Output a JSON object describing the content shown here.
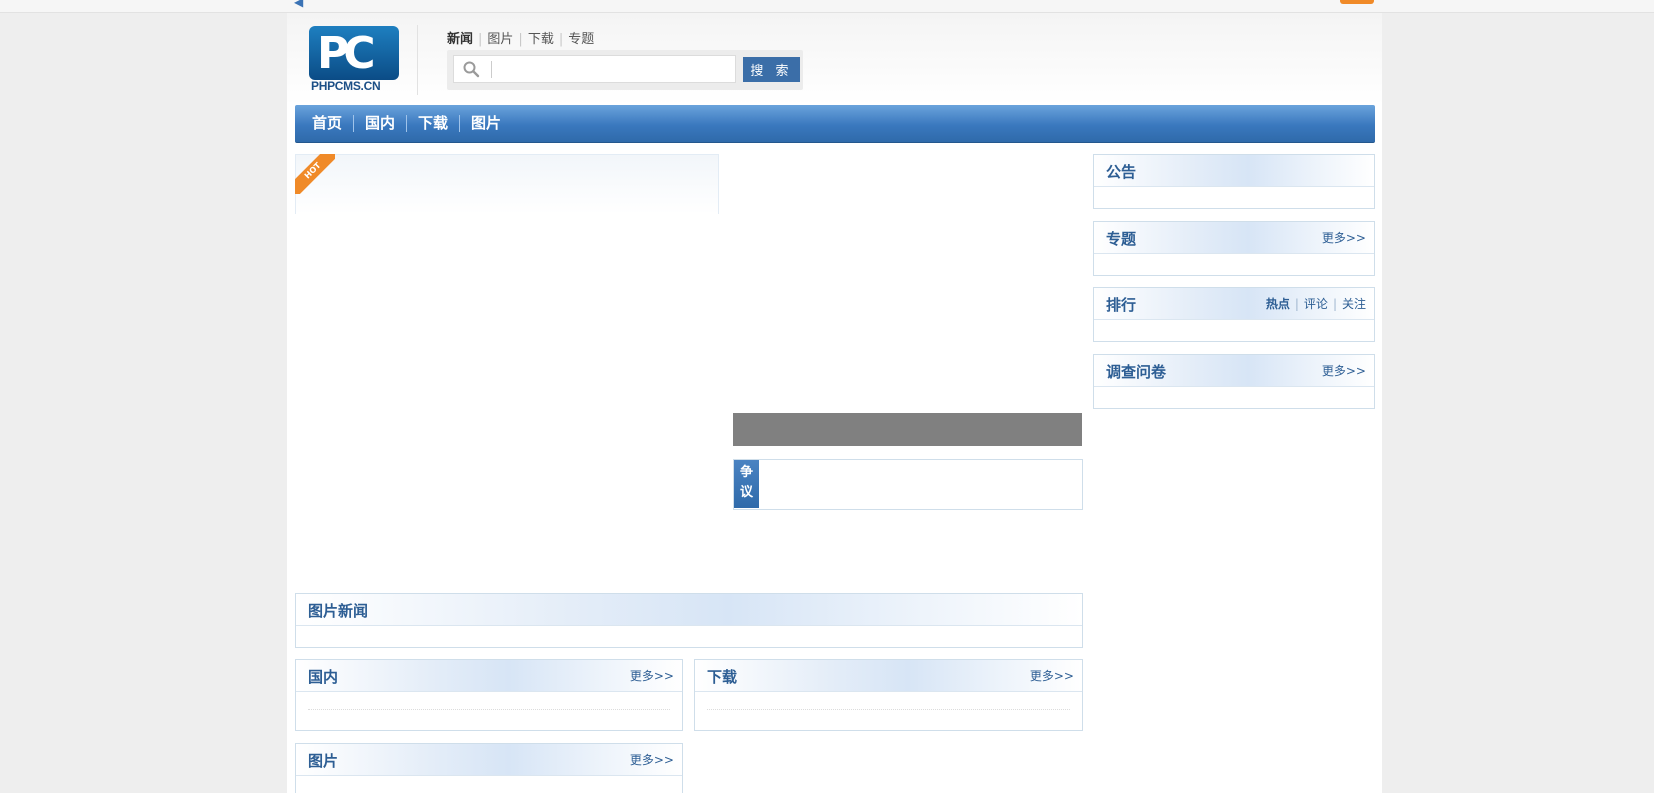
{
  "colors": {
    "accent": "#3b6ea8",
    "nav_blue": "#3a78be",
    "hot_orange": "#f08a28",
    "box_title": "#2d5e94",
    "page_bg": "#eeeeee"
  },
  "header": {
    "logo": {
      "mark": "PC",
      "name": "PHPCMS.CN"
    },
    "channel_tabs": [
      {
        "label": "新闻",
        "active": true
      },
      {
        "label": "图片",
        "active": false
      },
      {
        "label": "下载",
        "active": false
      },
      {
        "label": "专题",
        "active": false
      }
    ],
    "search": {
      "icon": "search-icon",
      "value": "",
      "placeholder": "",
      "button_label": "搜 索"
    }
  },
  "nav": {
    "items": [
      "首页",
      "国内",
      "下载",
      "图片"
    ]
  },
  "focus": {
    "hot_label": "HOT"
  },
  "dispute": {
    "tag_chars": [
      "争",
      "议"
    ]
  },
  "sidebar": {
    "announcement": {
      "title": "公告"
    },
    "topics": {
      "title": "专题",
      "more": "更多>>"
    },
    "ranking": {
      "title": "排行",
      "tabs": [
        "热点",
        "评论",
        "关注"
      ]
    },
    "survey": {
      "title": "调查问卷",
      "more": "更多>>"
    }
  },
  "sections": {
    "photo_news": {
      "title": "图片新闻"
    },
    "domestic": {
      "title": "国内",
      "more": "更多>>"
    },
    "download": {
      "title": "下载",
      "more": "更多>>"
    },
    "pictures": {
      "title": "图片",
      "more": "更多>>"
    }
  }
}
